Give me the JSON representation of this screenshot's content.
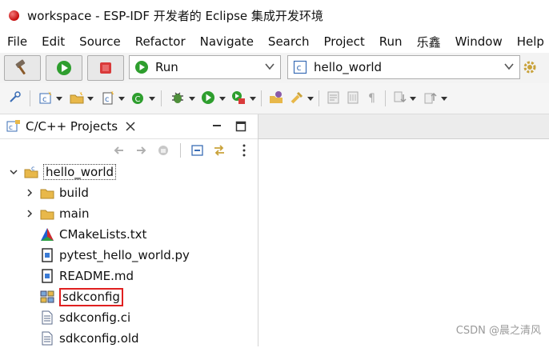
{
  "window": {
    "title": "workspace - ESP-IDF 开发者的 Eclipse 集成开发环境"
  },
  "menu": [
    "File",
    "Edit",
    "Source",
    "Refactor",
    "Navigate",
    "Search",
    "Project",
    "Run",
    "乐鑫",
    "Window",
    "Help"
  ],
  "launch": {
    "mode_value": "Run",
    "target_value": "hello_world"
  },
  "project_explorer": {
    "tab_label": "C/C++ Projects",
    "tree": [
      {
        "label": "hello_world",
        "level": 0,
        "kind": "project",
        "expanded": true
      },
      {
        "label": "build",
        "level": 1,
        "kind": "folder",
        "expanded": false
      },
      {
        "label": "main",
        "level": 1,
        "kind": "folder",
        "expanded": false
      },
      {
        "label": "CMakeLists.txt",
        "level": 1,
        "kind": "cmake"
      },
      {
        "label": "pytest_hello_world.py",
        "level": 1,
        "kind": "python"
      },
      {
        "label": "README.md",
        "level": 1,
        "kind": "markdown"
      },
      {
        "label": "sdkconfig",
        "level": 1,
        "kind": "sdkconfig",
        "highlighted": true
      },
      {
        "label": "sdkconfig.ci",
        "level": 1,
        "kind": "text"
      },
      {
        "label": "sdkconfig.old",
        "level": 1,
        "kind": "text"
      }
    ]
  },
  "watermark": "CSDN @晨之清风",
  "colors": {
    "highlight_box": "#e02020",
    "run_green": "#2e9e2e",
    "stop_red": "#d93a3a",
    "folder_yellow": "#e8b84a"
  }
}
